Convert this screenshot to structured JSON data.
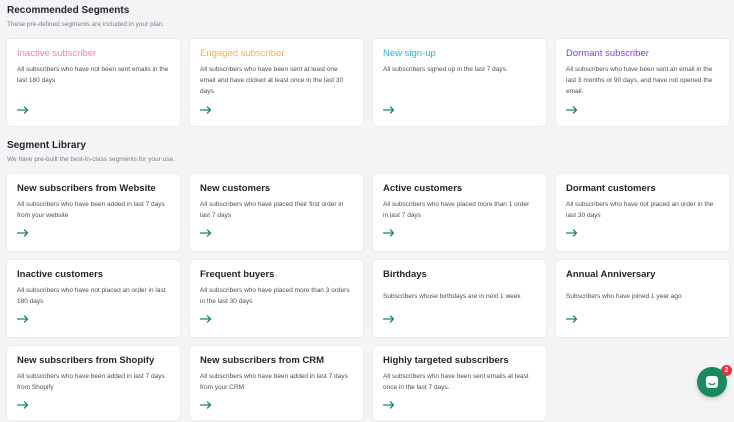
{
  "recommended": {
    "title": "Recommended Segments",
    "subtitle": "These pre-defined segments are included in your plan.",
    "cards": [
      {
        "title": "Inactive subscriber",
        "desc": "All subscribers who have not been sent emails in the last 180 days",
        "color": "#ef7fb8"
      },
      {
        "title": "Engaged subscriber",
        "desc": "All subscribers who have been sent at least one email and have clicked at least once in the last 30 days.",
        "color": "#f2b04a"
      },
      {
        "title": "New sign-up",
        "desc": "All subscribers signed up in the last 7 days.",
        "color": "#25b7d9"
      },
      {
        "title": "Dormant subscriber",
        "desc": "All subscribers who have been sent an email in the last 3 months or 90 days, and have not opened the email.",
        "color": "#8a38e0"
      }
    ]
  },
  "library": {
    "title": "Segment Library",
    "subtitle": "We have pre-built the best-in-class segments for your use.",
    "cards": [
      {
        "title": "New subscribers from Website",
        "desc": "All subscribers who have been added in last 7 days from your website"
      },
      {
        "title": "New customers",
        "desc": "All subscribers who have placed their first order in last 7 days"
      },
      {
        "title": "Active customers",
        "desc": "All subscribers who have placed more than 1 order in last 7 days"
      },
      {
        "title": "Dormant customers",
        "desc": "All subscribers who have not placed an order in the last 30 days"
      },
      {
        "title": "Inactive customers",
        "desc": "All subscribers who have not placed an order in last 180 days"
      },
      {
        "title": "Frequent buyers",
        "desc": "All subscribers who have placed more than 3 orders in the last 30 days"
      },
      {
        "title": "Birthdays",
        "desc": "Subscribers whose birthdays are in next 1 week"
      },
      {
        "title": "Annual Anniversary",
        "desc": "Subscribers who have joined 1 year ago"
      },
      {
        "title": "New subscribers from Shopify",
        "desc": "All subscribers who have been added in last 7 days from Shopify"
      },
      {
        "title": "New subscribers from CRM",
        "desc": "All subscribers who have been added in last 7 days from your CRM"
      },
      {
        "title": "Highly targeted subscribers",
        "desc": "All subscribers who have been sent emails at least once in the last 7 days."
      }
    ]
  },
  "chat": {
    "badge": "2"
  },
  "colors": {
    "accent": "#1a8a5e",
    "badge": "#e5333b"
  },
  "icons": {
    "card_arrow": "arrow-right-icon",
    "chat": "chat-icon"
  }
}
